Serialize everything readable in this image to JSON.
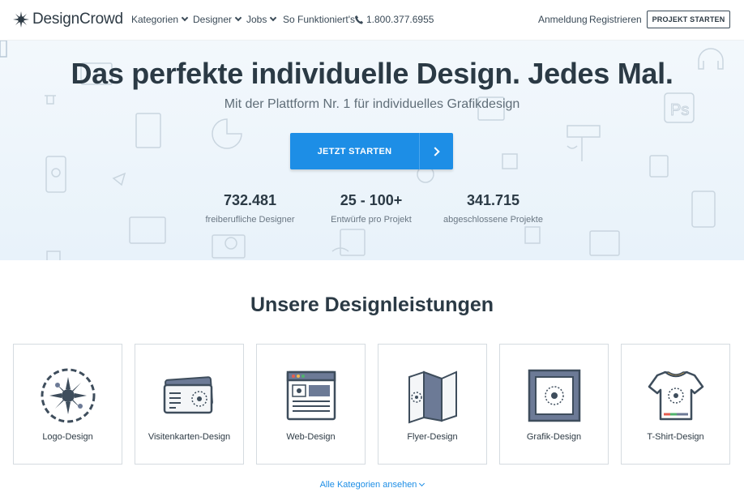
{
  "nav": {
    "brand": "DesignCrowd",
    "links": [
      {
        "label": "Kategorien",
        "icon": "chevron-down-icon"
      },
      {
        "label": "Designer",
        "icon": "chevron-down-icon"
      },
      {
        "label": "Jobs",
        "icon": "chevron-down-icon"
      },
      {
        "label": "So Funktioniert's"
      }
    ],
    "phone": "1.800.377.6955",
    "login": "Anmeldung",
    "register": "Registrieren",
    "cta": "PROJEKT STARTEN"
  },
  "hero": {
    "title": "Das perfekte individuelle Design. Jedes Mal.",
    "subtitle": "Mit der Plattform Nr. 1 für individuelles Grafikdesign",
    "cta": "JETZT STARTEN",
    "stats": [
      {
        "value": "732.481",
        "label": "freiberufliche Designer"
      },
      {
        "value": "25 - 100+",
        "label": "Entwürfe pro Projekt"
      },
      {
        "value": "341.715",
        "label": "abgeschlossene Projekte"
      }
    ]
  },
  "services": {
    "title": "Unsere Designleistungen",
    "items": [
      {
        "label": "Logo-Design",
        "icon": "logo-design-icon"
      },
      {
        "label": "Visitenkarten-Design",
        "icon": "business-card-icon"
      },
      {
        "label": "Web-Design",
        "icon": "web-design-icon"
      },
      {
        "label": "Flyer-Design",
        "icon": "flyer-icon"
      },
      {
        "label": "Grafik-Design",
        "icon": "graphic-design-icon"
      },
      {
        "label": "T-Shirt-Design",
        "icon": "tshirt-icon"
      }
    ],
    "all_link": "Alle Kategorien ansehen"
  },
  "colors": {
    "accent": "#1d8ee6",
    "text": "#2b3a45",
    "icon_dark": "#3e4d5c",
    "icon_blue_gray": "#6c7a96"
  }
}
